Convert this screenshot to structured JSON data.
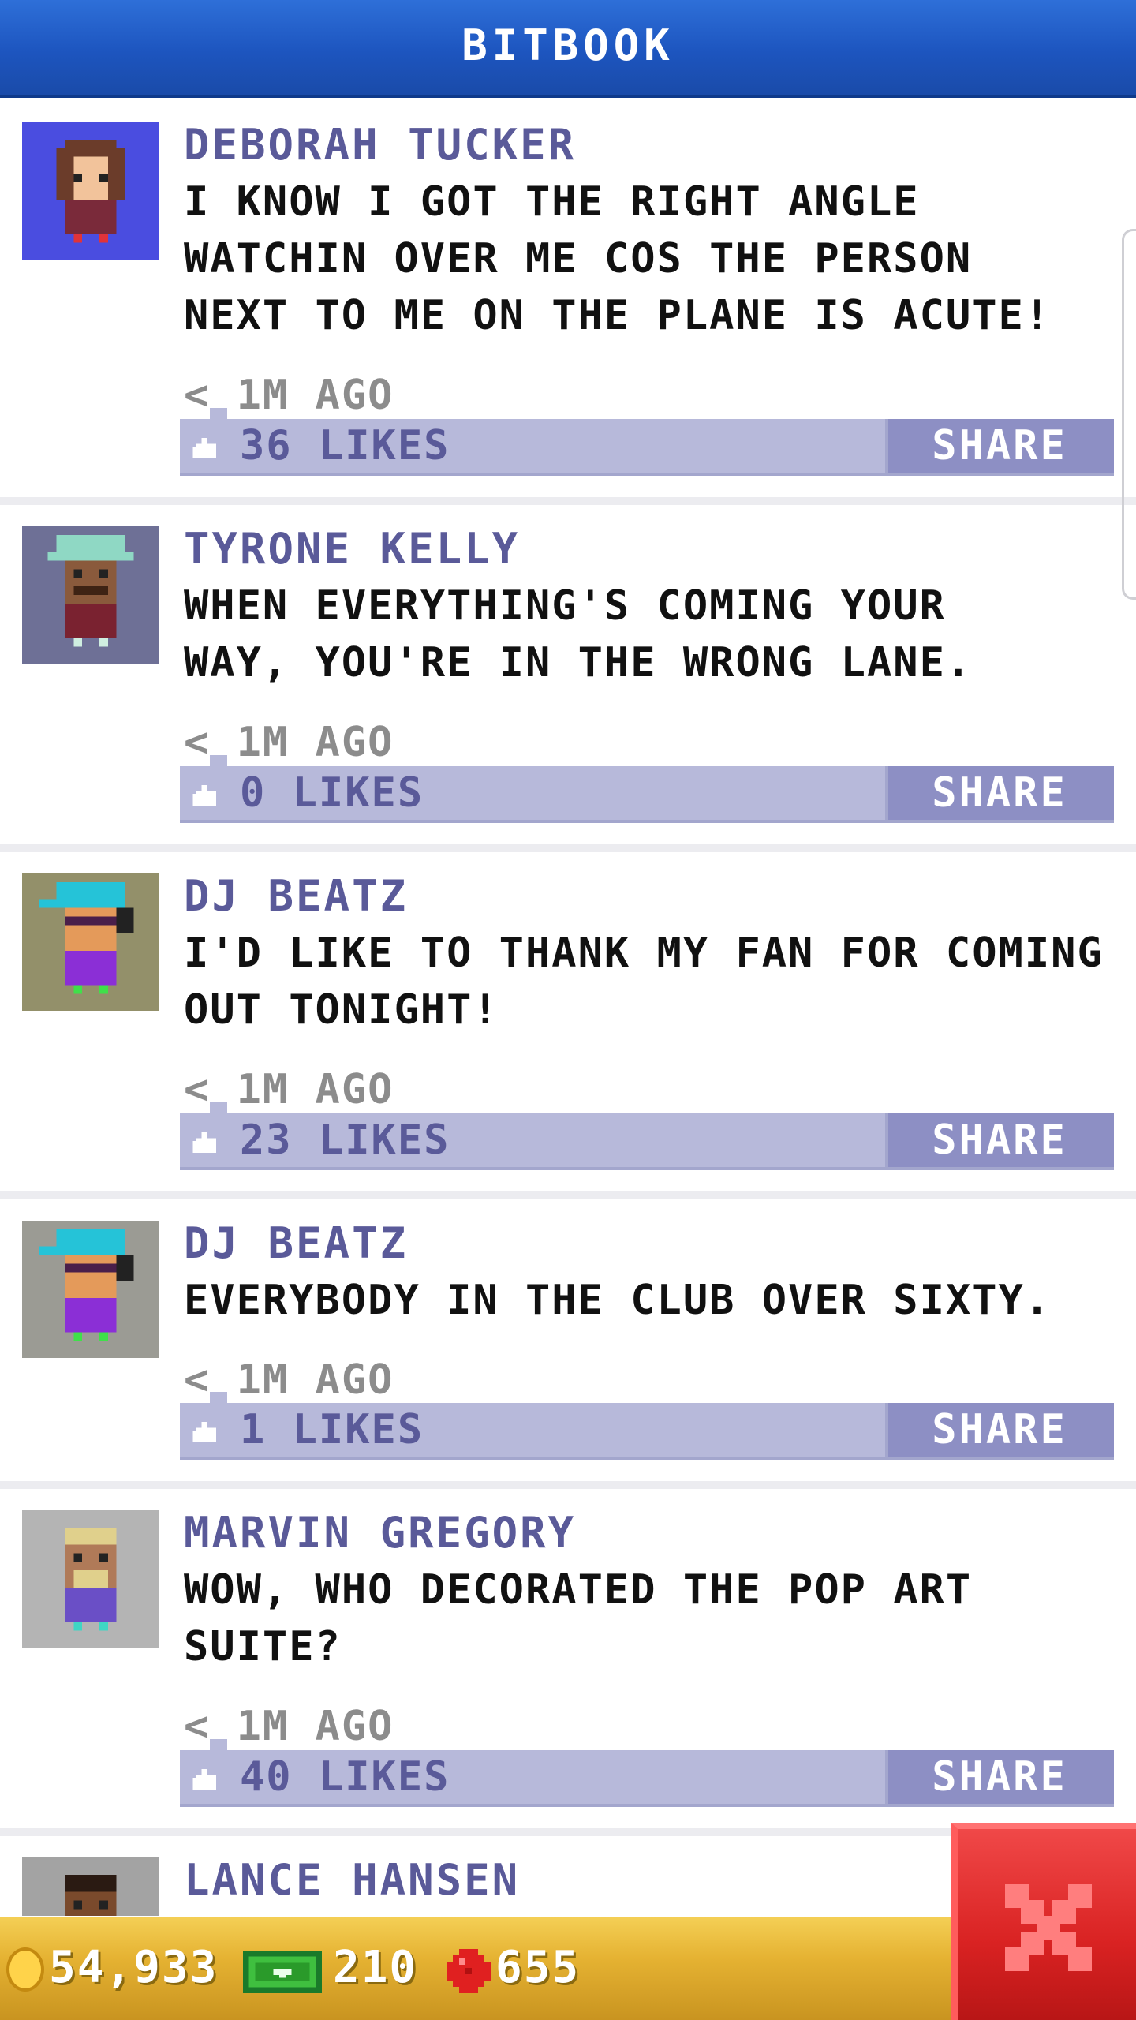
{
  "header": {
    "title": "BITBOOK"
  },
  "posts": [
    {
      "author": "DEBORAH TUCKER",
      "message": "I KNOW I GOT THE RIGHT ANGLE\nWATCHIN OVER ME COS THE PERSON\nNEXT TO ME ON THE PLANE IS ACUTE!",
      "time": "< 1M AGO",
      "likes": "36 LIKES",
      "share_label": "SHARE",
      "avatar_bg": "#4a4de0"
    },
    {
      "author": "TYRONE KELLY",
      "message": "WHEN EVERYTHING'S COMING YOUR\nWAY, YOU'RE IN THE WRONG LANE.",
      "time": "< 1M AGO",
      "likes": "0 LIKES",
      "share_label": "SHARE",
      "avatar_bg": "#6e7096"
    },
    {
      "author": "DJ BEATZ",
      "message": "I'D LIKE TO THANK MY FAN FOR COMING\nOUT TONIGHT!",
      "time": "< 1M AGO",
      "likes": "23 LIKES",
      "share_label": "SHARE",
      "avatar_bg": "#93906a"
    },
    {
      "author": "DJ BEATZ",
      "message": "EVERYBODY IN THE CLUB OVER SIXTY.",
      "time": "< 1M AGO",
      "likes": "1 LIKES",
      "share_label": "SHARE",
      "avatar_bg": "#9b9b94"
    },
    {
      "author": "MARVIN GREGORY",
      "message": "WOW, WHO DECORATED THE POP ART\nSUITE?",
      "time": "< 1M AGO",
      "likes": "40 LIKES",
      "share_label": "SHARE",
      "avatar_bg": "#b4b4b4"
    },
    {
      "author": "LANCE HANSEN",
      "avatar_bg": "#a3a3a3"
    }
  ],
  "status": {
    "coins": "54,933",
    "bux": "210",
    "gems": "655"
  },
  "colors": {
    "header": "#1d55bf",
    "author_text": "#5a5a99",
    "like_bar": "#b7b9da",
    "share_button": "#8d8fc4",
    "status_bar": "#e5b232",
    "close_button": "#d92222"
  },
  "icons": {
    "like": "thumb-up-icon",
    "coin": "coin-icon",
    "bux": "cash-icon",
    "gem": "gem-icon",
    "close": "close-icon"
  }
}
